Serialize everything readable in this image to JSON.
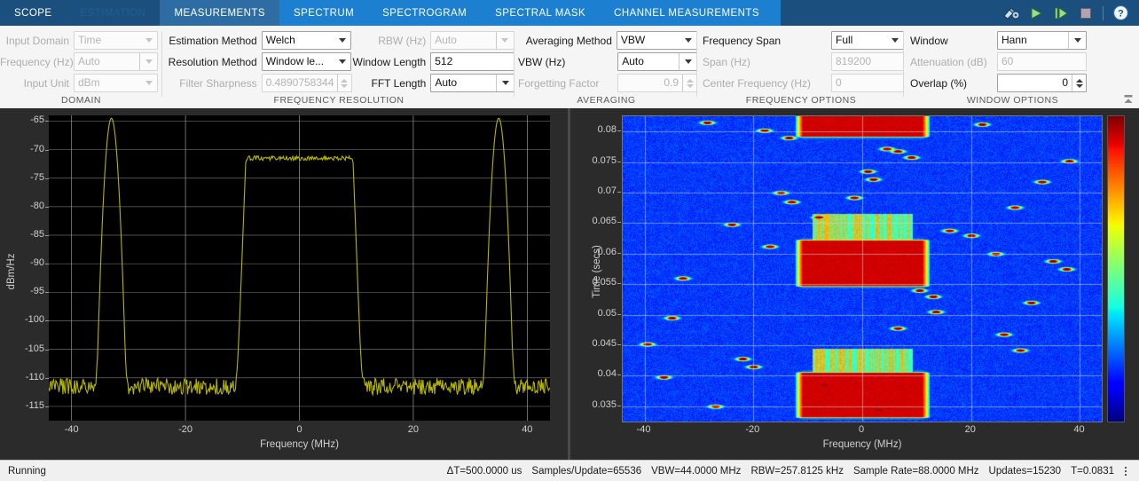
{
  "tabs": {
    "primary": [
      {
        "label": "SCOPE",
        "state": "normal"
      },
      {
        "label": "ESTIMATION",
        "state": "disabled"
      },
      {
        "label": "MEASUREMENTS",
        "state": "active"
      }
    ],
    "secondary": [
      {
        "label": "SPECTRUM"
      },
      {
        "label": "SPECTROGRAM"
      },
      {
        "label": "SPECTRAL MASK"
      },
      {
        "label": "CHANNEL MEASUREMENTS"
      }
    ],
    "icons": [
      {
        "name": "scope-settings-icon",
        "title": "Settings"
      },
      {
        "name": "run-icon",
        "title": "Run"
      },
      {
        "name": "step-forward-icon",
        "title": "Step Forward"
      },
      {
        "name": "stop-icon",
        "title": "Stop"
      },
      {
        "name": "help-icon",
        "title": "Help"
      }
    ]
  },
  "ribbon": {
    "groups": [
      {
        "name": "DOMAIN",
        "rows": [
          {
            "label": "Input Domain",
            "value": "Time",
            "type": "dropdown",
            "enabled": false
          },
          {
            "label": "Frequency (Hz)",
            "value": "Auto",
            "type": "dropdown-split",
            "enabled": false
          },
          {
            "label": "Input Unit",
            "value": "dBm",
            "type": "dropdown",
            "enabled": false
          }
        ]
      },
      {
        "name": "FREQUENCY RESOLUTION",
        "rows": [
          {
            "label": "Estimation Method",
            "value": "Welch",
            "type": "dropdown",
            "enabled": true
          },
          {
            "label": "Resolution Method",
            "value": "Window le...",
            "type": "dropdown",
            "enabled": true
          },
          {
            "label": "Filter Sharpness",
            "value": "0.4890758344",
            "type": "spinner",
            "enabled": false
          }
        ]
      },
      {
        "name": "FREQUENCY RESOLUTION",
        "rows": [
          {
            "label": "RBW (Hz)",
            "value": "Auto",
            "type": "dropdown-split",
            "enabled": false
          },
          {
            "label": "Window Length",
            "value": "512",
            "type": "text",
            "enabled": true
          },
          {
            "label": "FFT Length",
            "value": "Auto",
            "type": "dropdown-split",
            "enabled": true
          }
        ]
      },
      {
        "name": "AVERAGING",
        "rows": [
          {
            "label": "Averaging Method",
            "value": "VBW",
            "type": "dropdown",
            "enabled": true
          },
          {
            "label": "VBW (Hz)",
            "value": "Auto",
            "type": "dropdown-split",
            "enabled": true
          },
          {
            "label": "Forgetting Factor",
            "value": "0.9",
            "type": "spinner",
            "enabled": false
          }
        ]
      },
      {
        "name": "FREQUENCY OPTIONS",
        "rows": [
          {
            "label": "Frequency Span",
            "value": "Full",
            "type": "dropdown",
            "enabled": true
          },
          {
            "label": "Span (Hz)",
            "value": "819200",
            "type": "text",
            "enabled": false
          },
          {
            "label": "Center Frequency (Hz)",
            "value": "0",
            "type": "text",
            "enabled": false
          }
        ]
      },
      {
        "name": "WINDOW OPTIONS",
        "rows": [
          {
            "label": "Window",
            "value": "Hann",
            "type": "dropdown-split",
            "enabled": true
          },
          {
            "label": "Attenuation (dB)",
            "value": "60",
            "type": "text",
            "enabled": false
          },
          {
            "label": "Overlap (%)",
            "value": "0",
            "type": "spinner",
            "enabled": true
          }
        ]
      }
    ],
    "collapse_icon": "collapse-ribbon-icon"
  },
  "chart_data": [
    {
      "type": "line",
      "name": "spectrum-plot",
      "title": "",
      "xlabel": "Frequency (MHz)",
      "ylabel": "dBm/Hz",
      "xlim": [
        -44,
        44
      ],
      "ylim": [
        -117.5,
        -64
      ],
      "xticks": [
        -40,
        -20,
        0,
        20,
        40
      ],
      "yticks": [
        -65,
        -70,
        -75,
        -80,
        -85,
        -90,
        -95,
        -100,
        -105,
        -110,
        -115
      ],
      "grid": true,
      "trace_color": "#b5b500",
      "background": "#000000",
      "noise_floor_dbm": -111.5,
      "series": [
        {
          "name": "Welch PSD estimate",
          "features": [
            {
              "kind": "noise",
              "from": -44,
              "to": 44,
              "level": -111.5,
              "ripple": 1.2
            },
            {
              "kind": "tone",
              "center": -33.0,
              "peak": -64.5,
              "width": 1.4
            },
            {
              "kind": "tone",
              "center": 35.0,
              "peak": -64.5,
              "width": 1.4
            },
            {
              "kind": "band",
              "from": -11.0,
              "to": 11.0,
              "level": -71.5,
              "edge": 1.6,
              "ripple": 0.8
            }
          ]
        }
      ]
    },
    {
      "type": "heatmap",
      "name": "spectrogram-plot",
      "title": "",
      "xlabel": "Frequency (MHz)",
      "ylabel": "Time (secs)",
      "xlim": [
        -44,
        44
      ],
      "ylim": [
        0.0325,
        0.0825
      ],
      "xticks": [
        -40,
        -20,
        0,
        20,
        40
      ],
      "yticks": [
        0.035,
        0.04,
        0.045,
        0.05,
        0.055,
        0.06,
        0.065,
        0.07,
        0.075,
        0.08
      ],
      "grid": true,
      "colormap": "jet",
      "colorbar": true,
      "background_level": 0.18,
      "wideband_bursts": [
        {
          "time_from": 0.079,
          "time_to": 0.0835,
          "freq_from": -11,
          "freq_to": 11,
          "level": 0.93
        },
        {
          "time_from": 0.0545,
          "time_to": 0.0625,
          "freq_from": -11,
          "freq_to": 11,
          "level": 0.93
        },
        {
          "time_from": 0.033,
          "time_to": 0.0408,
          "freq_from": -11,
          "freq_to": 11,
          "level": 0.93
        }
      ],
      "striped_bursts": [
        {
          "time_from": 0.0625,
          "time_to": 0.0665,
          "freq_from": -9,
          "freq_to": 9,
          "level": 0.55
        },
        {
          "time_from": 0.0408,
          "time_to": 0.0443,
          "freq_from": -9,
          "freq_to": 9,
          "level": 0.55
        }
      ],
      "hopping_tones": [
        {
          "time": 0.0815,
          "freq": -28.5
        },
        {
          "time": 0.0802,
          "freq": -18.0
        },
        {
          "time": 0.0812,
          "freq": 22.0
        },
        {
          "time": 0.079,
          "freq": -13.5
        },
        {
          "time": 0.0772,
          "freq": 4.5
        },
        {
          "time": 0.0768,
          "freq": 6.5
        },
        {
          "time": 0.0758,
          "freq": 9.0
        },
        {
          "time": 0.0752,
          "freq": 38.0
        },
        {
          "time": 0.0735,
          "freq": 1.0
        },
        {
          "time": 0.0722,
          "freq": 2.0
        },
        {
          "time": 0.0718,
          "freq": 33.0
        },
        {
          "time": 0.07,
          "freq": -15.0
        },
        {
          "time": 0.0692,
          "freq": -1.5
        },
        {
          "time": 0.0685,
          "freq": -13.0
        },
        {
          "time": 0.0676,
          "freq": 28.0
        },
        {
          "time": 0.066,
          "freq": -8.0
        },
        {
          "time": 0.0648,
          "freq": -24.0
        },
        {
          "time": 0.0638,
          "freq": 16.0
        },
        {
          "time": 0.063,
          "freq": 20.0
        },
        {
          "time": 0.0612,
          "freq": -17.0
        },
        {
          "time": 0.06,
          "freq": 24.5
        },
        {
          "time": 0.0588,
          "freq": 35.0
        },
        {
          "time": 0.0575,
          "freq": 37.5
        },
        {
          "time": 0.056,
          "freq": -33.0
        },
        {
          "time": 0.054,
          "freq": 10.5
        },
        {
          "time": 0.053,
          "freq": 13.0
        },
        {
          "time": 0.052,
          "freq": 31.0
        },
        {
          "time": 0.0505,
          "freq": 13.5
        },
        {
          "time": 0.0495,
          "freq": -35.0
        },
        {
          "time": 0.0478,
          "freq": 6.5
        },
        {
          "time": 0.0468,
          "freq": 26.0
        },
        {
          "time": 0.0452,
          "freq": -39.5
        },
        {
          "time": 0.0442,
          "freq": 29.0
        },
        {
          "time": 0.0428,
          "freq": -22.0
        },
        {
          "time": 0.0415,
          "freq": -20.0
        },
        {
          "time": 0.0398,
          "freq": -36.5
        },
        {
          "time": 0.0385,
          "freq": -7.0
        },
        {
          "time": 0.035,
          "freq": -27.0
        },
        {
          "time": 0.0345,
          "freq": 3.0
        }
      ]
    }
  ],
  "status": {
    "state": "Running",
    "metrics": [
      "ΔT=500.0000 us",
      "Samples/Update=65536",
      "VBW=44.0000 MHz",
      "RBW=257.8125 kHz",
      "Sample Rate=88.0000 MHz",
      "Updates=15230",
      "T=0.0831"
    ],
    "overflow_icon": "kebab-menu-icon"
  }
}
